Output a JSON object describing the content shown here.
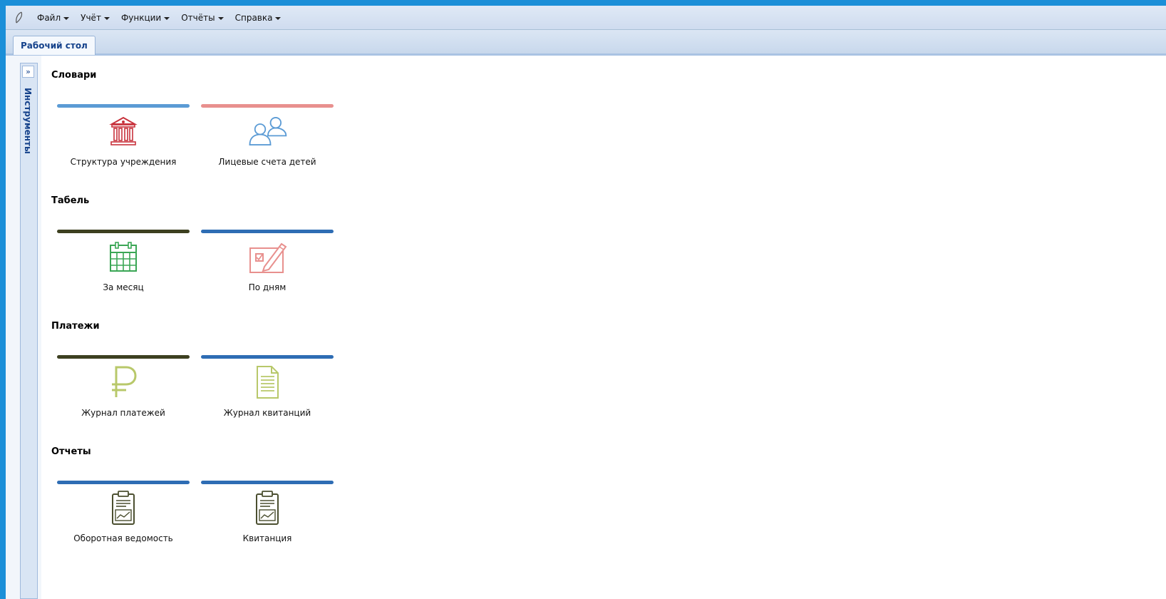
{
  "menu": [
    {
      "label": "Файл"
    },
    {
      "label": "Учёт"
    },
    {
      "label": "Функции"
    },
    {
      "label": "Отчёты"
    },
    {
      "label": "Справка"
    }
  ],
  "tabs": [
    {
      "label": "Рабочий стол",
      "active": true
    }
  ],
  "tools_panel": {
    "title": "Инструменты"
  },
  "sections": [
    {
      "title": "Словари",
      "tiles": [
        {
          "label": "Структура учреждения",
          "icon": "institution-building-icon",
          "bar_color": "#5b9bd5"
        },
        {
          "label": "Лицевые счета детей",
          "icon": "people-accounts-icon",
          "bar_color": "#e8908e"
        }
      ]
    },
    {
      "title": "Табель",
      "tiles": [
        {
          "label": "За месяц",
          "icon": "calendar-grid-icon",
          "bar_color": "#3d4020"
        },
        {
          "label": "По дням",
          "icon": "checkbox-pencil-icon",
          "bar_color": "#2e6db4"
        }
      ]
    },
    {
      "title": "Платежи",
      "tiles": [
        {
          "label": "Журнал платежей",
          "icon": "ruble-icon",
          "bar_color": "#3d4020"
        },
        {
          "label": "Журнал квитанций",
          "icon": "document-lines-icon",
          "bar_color": "#2e6db4"
        }
      ]
    },
    {
      "title": "Отчеты",
      "tiles": [
        {
          "label": "Оборотная ведомость",
          "icon": "clipboard-chart-icon",
          "bar_color": "#2e6db4"
        },
        {
          "label": "Квитанция",
          "icon": "clipboard-chart-icon",
          "bar_color": "#2e6db4"
        }
      ]
    }
  ],
  "colors": {
    "frame": "#1b8fd8",
    "tab_text": "#15428b",
    "icon_red": "#c8323c",
    "icon_blue": "#5b9bd5",
    "icon_green": "#3aa655",
    "icon_pink": "#e8908e",
    "icon_olive": "#b8c86a",
    "icon_dark": "#4b4f30"
  }
}
